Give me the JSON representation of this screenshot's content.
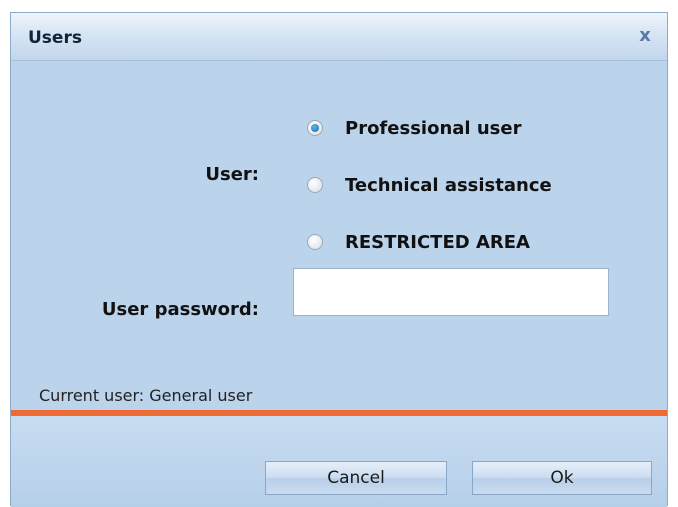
{
  "dialog": {
    "title": "Users",
    "close_label": "x"
  },
  "form": {
    "user_label": "User:",
    "user_options": [
      {
        "label": "Professional user",
        "checked": true
      },
      {
        "label": "Technical assistance",
        "checked": false
      },
      {
        "label": "RESTRICTED AREA",
        "checked": false
      }
    ],
    "password_label": "User password:",
    "password_value": "",
    "status_text": "Current user: General user"
  },
  "buttons": {
    "cancel_label": "Cancel",
    "ok_label": "Ok"
  },
  "colors": {
    "separator": "#ef6a34",
    "panel_background": "#bcd3ec"
  }
}
